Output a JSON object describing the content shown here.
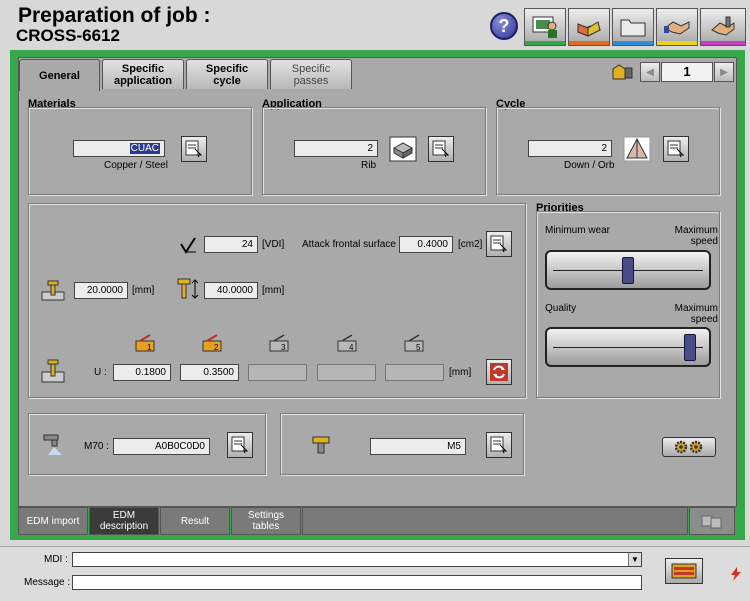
{
  "header": {
    "title": "Preparation of job :",
    "job_name": "CROSS-6612",
    "help_label": "?"
  },
  "tabs": [
    {
      "label": "General"
    },
    {
      "label": "Specific\napplication"
    },
    {
      "label": "Specific\ncycle"
    },
    {
      "label": "Specific\npasses"
    }
  ],
  "pager": {
    "value": "1"
  },
  "materials": {
    "title": "Materials",
    "code": "CUAC",
    "name": "Copper / Steel"
  },
  "application": {
    "title": "Application",
    "value": "2",
    "name": "Rib"
  },
  "cycle": {
    "title": "Cycle",
    "value": "2",
    "name": "Down / Orb"
  },
  "params": {
    "roughness_value": "24",
    "roughness_unit": "[VDI]",
    "attack_label": "Attack frontal surface :",
    "attack_value": "0.4000",
    "attack_unit": "[cm2]",
    "depth_value": "20.0000",
    "depth_unit": "[mm]",
    "height_value": "40.0000",
    "height_unit": "[mm]",
    "electrode_labels": [
      "1",
      "2",
      "3",
      "4",
      "5"
    ],
    "u_label": "U :",
    "u_values": [
      "0.1800",
      "0.3500",
      "",
      "",
      ""
    ],
    "u_unit": "[mm]"
  },
  "priorities": {
    "title": "Priorities",
    "slider1_left": "Minimum wear",
    "slider1_right": "Maximum\nspeed",
    "slider1_level": 0.5,
    "slider2_left": "Quality",
    "slider2_right": "Maximum\nspeed",
    "slider2_level": 0.95
  },
  "m70": {
    "label": "M70 :",
    "value": "A0B0C0D0"
  },
  "fixture": {
    "value": "M5"
  },
  "bottom_tabs": [
    {
      "label": "EDM import"
    },
    {
      "label": "EDM\ndescription"
    },
    {
      "label": "Result"
    },
    {
      "label": "Settings\ntables"
    }
  ],
  "console": {
    "mdi_label": "MDI :",
    "mdi_value": "",
    "message_label": "Message :",
    "message_value": ""
  },
  "colors": {
    "frame_green": "#37a84a",
    "panel_gray": "#a9a9a9",
    "selection_blue": "#2b3a8f",
    "slider_knob": "#4a4d85"
  }
}
